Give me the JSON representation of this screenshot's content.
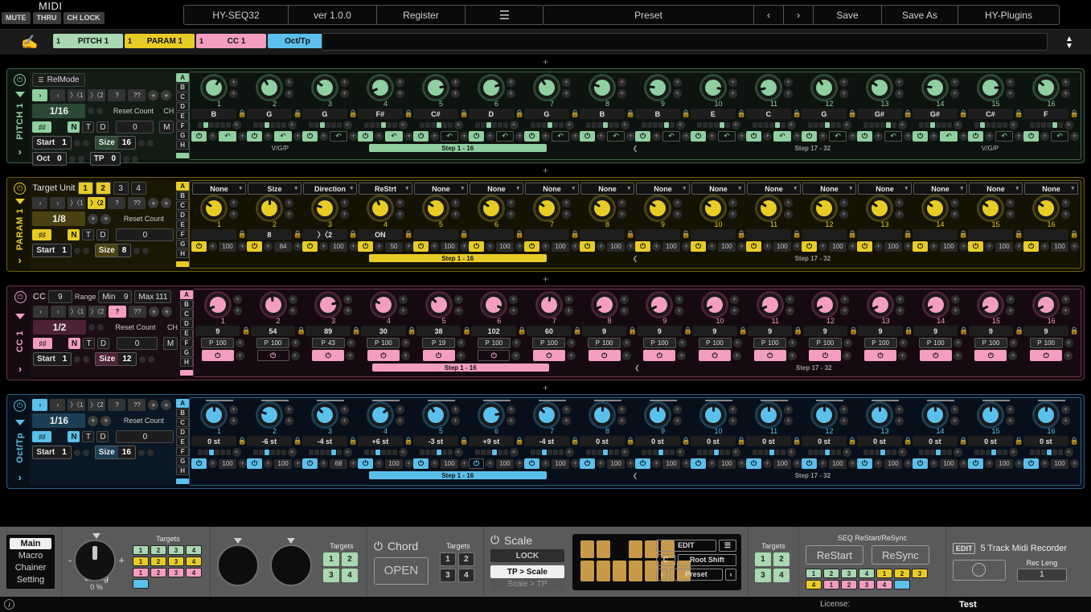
{
  "header": {
    "midi_label": "MIDI",
    "mini_buttons": [
      "MUTE",
      "THRU",
      "CH LOCK"
    ],
    "plugin_title": "HY-SEQ32",
    "version": "ver 1.0.0",
    "register": "Register",
    "menu_icon": "hamburger-icon",
    "preset": "Preset",
    "prev": "‹",
    "next": "›",
    "save": "Save",
    "save_as": "Save As",
    "brand": "HY-Plugins"
  },
  "chainbar": {
    "hand_icon": "hand-icon",
    "tabs": [
      {
        "num": "1",
        "label": "PITCH 1",
        "color": "#a9d8b2"
      },
      {
        "num": "1",
        "label": "PARAM 1",
        "color": "#e8cc26"
      },
      {
        "num": "1",
        "label": "CC 1",
        "color": "#f39ec0"
      },
      {
        "num": "",
        "label": "Oct/Tp",
        "color": "#5bc0eb"
      }
    ],
    "spinner_icon": "up-down-spinner-icon"
  },
  "add_lane_icon": "+",
  "lanes": [
    {
      "name": "PITCH 1",
      "color": "#8fcfa0",
      "dim": "#2c4a33",
      "bg": "#0d140f",
      "border": "#3c6645",
      "panel_bg": "#121c15",
      "relmode": {
        "icon": "sliders-icon",
        "label": "RelMode"
      },
      "nav": {
        "items": [
          "›",
          "‹",
          "〉〈1",
          "〉〈2",
          "?",
          "??"
        ],
        "active": 0
      },
      "rate": "1/16",
      "reset_count_label": "Reset Count",
      "reset_count": "0",
      "ch_label": "CH",
      "ch_value": "M",
      "ntd": [
        "N",
        "T",
        "D"
      ],
      "ntd_active": "N",
      "start_label": "Start",
      "start": "1",
      "size_label": "Size",
      "size": "16",
      "oct_label": "Oct",
      "oct": "0",
      "tp_label": "TP",
      "tp": "0",
      "abcd": [
        "A",
        "B",
        "C",
        "D",
        "E",
        "F",
        "G",
        "H"
      ],
      "abcd_active": "A",
      "footer_left": "V/G/P",
      "footer_right": "V/G/P",
      "step_label_1": "Step   1 - 16",
      "step_label_2": "Step   17 - 32",
      "steps": [
        {
          "n": "1",
          "v": "B",
          "knob": 62,
          "bar": 1,
          "on": true,
          "alt": true
        },
        {
          "n": "2",
          "v": "G",
          "knob": 38,
          "bar": 2,
          "on": true,
          "alt": true
        },
        {
          "n": "3",
          "v": "G",
          "knob": 30,
          "bar": 2,
          "on": true,
          "alt": false
        },
        {
          "n": "4",
          "v": "F#",
          "knob": 10,
          "bar": 3,
          "on": true,
          "alt": true
        },
        {
          "n": "5",
          "v": "C#",
          "knob": 80,
          "bar": 3,
          "on": true,
          "alt": false
        },
        {
          "n": "6",
          "v": "D",
          "knob": 75,
          "bar": 2,
          "on": true,
          "alt": false
        },
        {
          "n": "7",
          "v": "G",
          "knob": 38,
          "bar": 3,
          "on": true,
          "alt": false
        },
        {
          "n": "8",
          "v": "B",
          "knob": 25,
          "bar": 3,
          "on": true,
          "alt": false
        },
        {
          "n": "9",
          "v": "B",
          "knob": 20,
          "bar": 4,
          "on": true,
          "alt": false
        },
        {
          "n": "10",
          "v": "E",
          "knob": 85,
          "bar": 4,
          "on": true,
          "alt": false
        },
        {
          "n": "11",
          "v": "C",
          "knob": 14,
          "bar": 4,
          "on": true,
          "alt": true
        },
        {
          "n": "12",
          "v": "G",
          "knob": 38,
          "bar": 3,
          "on": true,
          "alt": false
        },
        {
          "n": "13",
          "v": "G#",
          "knob": 30,
          "bar": 4,
          "on": true,
          "alt": false
        },
        {
          "n": "14",
          "v": "G#",
          "knob": 20,
          "bar": 2,
          "on": true,
          "alt": true
        },
        {
          "n": "15",
          "v": "C#",
          "knob": 82,
          "bar": 1,
          "on": true,
          "alt": false
        },
        {
          "n": "16",
          "v": "F",
          "knob": 32,
          "bar": 4,
          "on": true,
          "alt": false
        }
      ]
    },
    {
      "name": "PARAM 1",
      "color": "#e8cc26",
      "dim": "#4a4212",
      "bg": "#141203",
      "border": "#6b5e10",
      "panel_bg": "#1a1705",
      "target_unit_label": "Target Unit",
      "target_units": [
        "1",
        "2",
        "3",
        "4"
      ],
      "target_units_active": [
        "1",
        "2"
      ],
      "nav": {
        "items": [
          "›",
          "‹",
          "〉〈1",
          "〉〈2",
          "?",
          "??"
        ],
        "active": 3
      },
      "rate": "1/8",
      "reset_count_label": "Reset Count",
      "reset_count": "0",
      "ntd": [
        "N",
        "T",
        "D"
      ],
      "ntd_active": "N",
      "start_label": "Start",
      "start": "1",
      "size_label": "Size",
      "size": "8",
      "abcd": [
        "A",
        "B",
        "C",
        "D",
        "E",
        "F",
        "G",
        "H"
      ],
      "abcd_active": "A",
      "step_label_1": "Step   1 - 16",
      "step_label_2": "Step   17 - 32",
      "steps": [
        {
          "n": "1",
          "sel": "None",
          "v": "",
          "knob": 30,
          "amt": "100",
          "on": true
        },
        {
          "n": "2",
          "sel": "Size",
          "v": "8",
          "knob": 50,
          "amt": "84",
          "on": true
        },
        {
          "n": "3",
          "sel": "Direction",
          "v": "〉〈2",
          "knob": 24,
          "amt": "100",
          "on": true
        },
        {
          "n": "4",
          "sel": "ReStrt",
          "v": "ON",
          "knob": 42,
          "amt": "50",
          "on": true
        },
        {
          "n": "5",
          "sel": "None",
          "v": "",
          "knob": 30,
          "amt": "100",
          "on": true
        },
        {
          "n": "6",
          "sel": "None",
          "v": "",
          "knob": 30,
          "amt": "100",
          "on": true
        },
        {
          "n": "7",
          "sel": "None",
          "v": "",
          "knob": 30,
          "amt": "100",
          "on": true
        },
        {
          "n": "8",
          "sel": "None",
          "v": "",
          "knob": 30,
          "amt": "100",
          "on": true
        },
        {
          "n": "9",
          "sel": "None",
          "v": "",
          "knob": 30,
          "amt": "100",
          "on": true
        },
        {
          "n": "10",
          "sel": "None",
          "v": "",
          "knob": 30,
          "amt": "100",
          "on": true
        },
        {
          "n": "11",
          "sel": "None",
          "v": "",
          "knob": 30,
          "amt": "100",
          "on": true
        },
        {
          "n": "12",
          "sel": "None",
          "v": "",
          "knob": 30,
          "amt": "100",
          "on": true
        },
        {
          "n": "13",
          "sel": "None",
          "v": "",
          "knob": 30,
          "amt": "100",
          "on": true
        },
        {
          "n": "14",
          "sel": "None",
          "v": "",
          "knob": 30,
          "amt": "100",
          "on": true
        },
        {
          "n": "15",
          "sel": "None",
          "v": "",
          "knob": 30,
          "amt": "100",
          "on": true
        },
        {
          "n": "16",
          "sel": "None",
          "v": "",
          "knob": 30,
          "amt": "100",
          "on": true
        }
      ]
    },
    {
      "name": "CC 1",
      "color": "#f39ec0",
      "dim": "#4d2236",
      "bg": "#150a10",
      "border": "#6b374e",
      "panel_bg": "#1b0d14",
      "cc_label": "CC",
      "cc_value": "9",
      "range_label": "Range",
      "min_label": "Min",
      "min_value": "9",
      "max_label": "Max",
      "max_value": "111",
      "nav": {
        "items": [
          "›",
          "‹",
          "〉〈1",
          "〉〈2",
          "?",
          "??"
        ],
        "active": 4
      },
      "rate": "1/2",
      "reset_count_label": "Reset Count",
      "reset_count": "0",
      "ch_label": "CH",
      "ch_value": "M",
      "ntd": [
        "N",
        "T",
        "D"
      ],
      "ntd_active": "N",
      "start_label": "Start",
      "start": "1",
      "size_label": "Size",
      "size": "12",
      "abcd": [
        "A",
        "B",
        "C",
        "D",
        "E",
        "F",
        "G",
        "H"
      ],
      "abcd_active": "A",
      "step_label_1": "Step   1 - 16",
      "step_label_2": "Step   17 - 32",
      "steps": [
        {
          "n": "1",
          "v": "9",
          "knob": 8,
          "p": "100",
          "on": true
        },
        {
          "n": "2",
          "v": "54",
          "knob": 48,
          "p": "100",
          "on": false
        },
        {
          "n": "3",
          "v": "89",
          "knob": 78,
          "p": "43",
          "on": true
        },
        {
          "n": "4",
          "v": "30",
          "knob": 27,
          "p": "100",
          "on": true
        },
        {
          "n": "5",
          "v": "38",
          "knob": 34,
          "p": "19",
          "on": true
        },
        {
          "n": "6",
          "v": "102",
          "knob": 90,
          "p": "100",
          "on": false
        },
        {
          "n": "7",
          "v": "60",
          "knob": 53,
          "p": "100",
          "on": true
        },
        {
          "n": "8",
          "v": "9",
          "knob": 8,
          "p": "100",
          "on": true
        },
        {
          "n": "9",
          "v": "9",
          "knob": 8,
          "p": "100",
          "on": true
        },
        {
          "n": "10",
          "v": "9",
          "knob": 8,
          "p": "100",
          "on": true
        },
        {
          "n": "11",
          "v": "9",
          "knob": 8,
          "p": "100",
          "on": true
        },
        {
          "n": "12",
          "v": "9",
          "knob": 8,
          "p": "100",
          "on": true
        },
        {
          "n": "13",
          "v": "9",
          "knob": 8,
          "p": "100",
          "on": true
        },
        {
          "n": "14",
          "v": "9",
          "knob": 8,
          "p": "100",
          "on": true
        },
        {
          "n": "15",
          "v": "9",
          "knob": 8,
          "p": "100",
          "on": true
        },
        {
          "n": "16",
          "v": "9",
          "knob": 8,
          "p": "100",
          "on": true
        }
      ]
    },
    {
      "name": "Oct/Tp",
      "color": "#5bc0eb",
      "dim": "#1d3f55",
      "bg": "#07101a",
      "border": "#2c5e7e",
      "panel_bg": "#0a1724",
      "nav": {
        "items": [
          "›",
          "‹",
          "〉〈1",
          "〉〈2",
          "?",
          "??"
        ],
        "active": 0
      },
      "rate": "1/16",
      "reset_count_label": "Reset Count",
      "reset_count": "0",
      "ntd": [
        "N",
        "T",
        "D"
      ],
      "ntd_active": "N",
      "start_label": "Start",
      "start": "1",
      "size_label": "Size",
      "size": "16",
      "abcd": [
        "A",
        "B",
        "C",
        "D",
        "E",
        "F",
        "G",
        "H"
      ],
      "abcd_active": "A",
      "step_label_1": "Step   1 - 16",
      "step_label_2": "Step   17 - 32",
      "steps": [
        {
          "n": "1",
          "v": "0 st",
          "knob": 50,
          "bar": 2,
          "amt": "100",
          "on": true
        },
        {
          "n": "2",
          "v": "-6 st",
          "knob": 25,
          "bar": 2,
          "amt": "100",
          "on": true
        },
        {
          "n": "3",
          "v": "-4 st",
          "knob": 33,
          "bar": 4,
          "amt": "68",
          "on": true
        },
        {
          "n": "4",
          "v": "+6 st",
          "knob": 68,
          "bar": 2,
          "amt": "100",
          "on": true
        },
        {
          "n": "5",
          "v": "-3 st",
          "knob": 38,
          "bar": 3,
          "amt": "100",
          "on": true
        },
        {
          "n": "6",
          "v": "+9 st",
          "knob": 80,
          "bar": 3,
          "amt": "100",
          "on": false
        },
        {
          "n": "7",
          "v": "-4 st",
          "knob": 33,
          "bar": 2,
          "amt": "100",
          "on": true
        },
        {
          "n": "8",
          "v": "0 st",
          "knob": 50,
          "bar": 3,
          "amt": "100",
          "on": true
        },
        {
          "n": "9",
          "v": "0 st",
          "knob": 50,
          "bar": 3,
          "amt": "100",
          "on": true
        },
        {
          "n": "10",
          "v": "0 st",
          "knob": 50,
          "bar": 3,
          "amt": "100",
          "on": true
        },
        {
          "n": "11",
          "v": "0 st",
          "knob": 50,
          "bar": 3,
          "amt": "100",
          "on": true
        },
        {
          "n": "12",
          "v": "0 st",
          "knob": 50,
          "bar": 3,
          "amt": "100",
          "on": true
        },
        {
          "n": "13",
          "v": "0 st",
          "knob": 50,
          "bar": 3,
          "amt": "100",
          "on": true
        },
        {
          "n": "14",
          "v": "0 st",
          "knob": 50,
          "bar": 3,
          "amt": "100",
          "on": true
        },
        {
          "n": "15",
          "v": "0 st",
          "knob": 50,
          "bar": 3,
          "amt": "100",
          "on": true
        },
        {
          "n": "16",
          "v": "0 st",
          "knob": 50,
          "bar": 3,
          "amt": "100",
          "on": true
        }
      ]
    }
  ],
  "bottom": {
    "pages": [
      "Main",
      "Macro",
      "Chainer",
      "Setting"
    ],
    "page_active": "Main",
    "swing": {
      "label": "Swing",
      "value": "0 %",
      "minus": "-",
      "plus": "+"
    },
    "targets_label": "Targets",
    "swing_targets": [
      {
        "t": "1",
        "c": "#a9d8b2"
      },
      {
        "t": "2",
        "c": "#a9d8b2"
      },
      {
        "t": "3",
        "c": "#a9d8b2"
      },
      {
        "t": "4",
        "c": "#a9d8b2"
      },
      {
        "t": "1",
        "c": "#e8cc26"
      },
      {
        "t": "2",
        "c": "#e8cc26"
      },
      {
        "t": "3",
        "c": "#e8cc26"
      },
      {
        "t": "4",
        "c": "#e8cc26"
      },
      {
        "t": "1",
        "c": "#f39ec0"
      },
      {
        "t": "2",
        "c": "#f39ec0"
      },
      {
        "t": "3",
        "c": "#f39ec0"
      },
      {
        "t": "4",
        "c": "#f39ec0"
      },
      {
        "t": "",
        "c": "#5bc0eb"
      }
    ],
    "mid_targets": [
      "1",
      "2",
      "3",
      "4"
    ],
    "chord": {
      "power_icon": "power-icon",
      "label": "Chord",
      "open": "OPEN",
      "targets_label": "Targets",
      "targets": [
        "1",
        "2",
        "3",
        "4"
      ]
    },
    "scale": {
      "power_icon": "power-icon",
      "label": "Scale",
      "lock": "LOCK",
      "tp_to_scale": "TP > Scale",
      "scale_to_tp": "Scale > TP",
      "edit": "EDIT",
      "menu_icon": "hamburger-icon",
      "root": "C",
      "root_shift": "Root Shift",
      "preset": "Preset",
      "prev": "‹",
      "next": "›",
      "white_keys": [
        true,
        true,
        true,
        true,
        true,
        true,
        true
      ],
      "black_keys": [
        true,
        true,
        false,
        true,
        true,
        true
      ]
    },
    "scale_targets_label": "Targets",
    "scale_targets": [
      "1",
      "2",
      "3",
      "4"
    ],
    "seq": {
      "title": "SEQ ReStart/ReSync",
      "restart": "ReStart",
      "resync": "ReSync",
      "leds": [
        {
          "t": "1",
          "c": "#a9d8b2"
        },
        {
          "t": "2",
          "c": "#a9d8b2"
        },
        {
          "t": "3",
          "c": "#a9d8b2"
        },
        {
          "t": "4",
          "c": "#a9d8b2"
        },
        {
          "t": "1",
          "c": "#e8cc26"
        },
        {
          "t": "2",
          "c": "#e8cc26"
        },
        {
          "t": "3",
          "c": "#e8cc26"
        },
        {
          "t": "4",
          "c": "#e8cc26"
        },
        {
          "t": "1",
          "c": "#f39ec0"
        },
        {
          "t": "2",
          "c": "#f39ec0"
        },
        {
          "t": "3",
          "c": "#f39ec0"
        },
        {
          "t": "4",
          "c": "#f39ec0"
        },
        {
          "t": "",
          "c": "#5bc0eb"
        }
      ]
    },
    "recorder": {
      "edit": "EDIT",
      "title": "5 Track Midi Recorder",
      "rec_icon": "record-circle-icon",
      "rec_len_label": "Rec Leng",
      "rec_len": "1"
    }
  },
  "status": {
    "info_icon": "info-icon",
    "license_label": "License:",
    "license_value": "Test"
  }
}
